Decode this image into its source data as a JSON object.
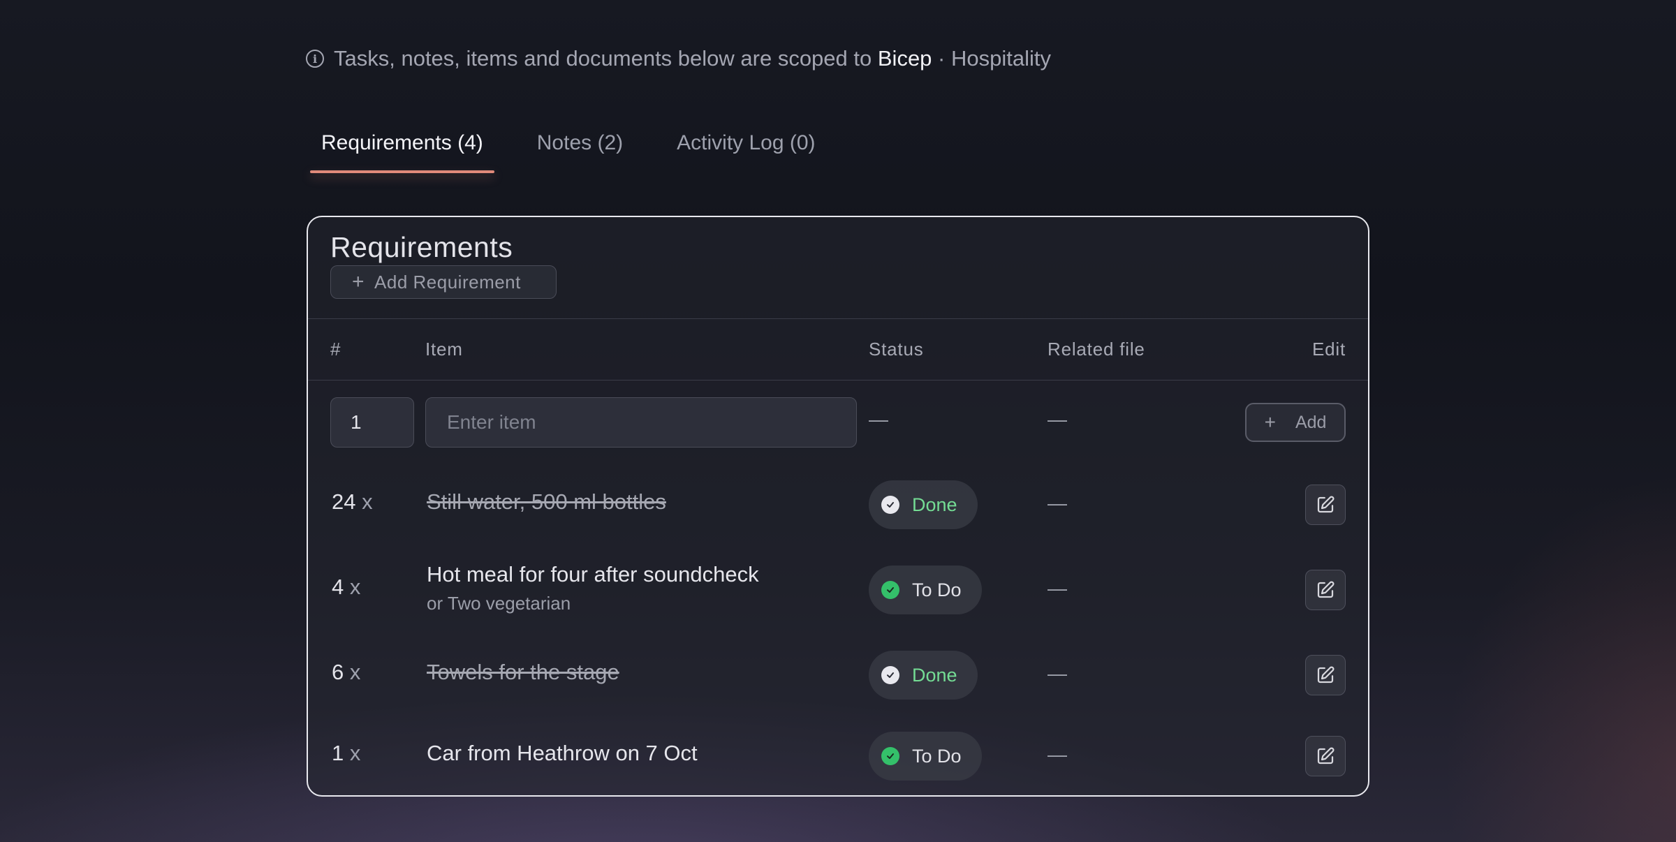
{
  "scope": {
    "prefix": "Tasks, notes, items and documents below are scoped to",
    "entity": "Bicep",
    "separator": "·",
    "category": "Hospitality",
    "icon": "info-icon"
  },
  "tabs": [
    {
      "label": "Requirements (4)",
      "active": true
    },
    {
      "label": "Notes (2)",
      "active": false
    },
    {
      "label": "Activity Log (0)",
      "active": false
    }
  ],
  "card": {
    "title": "Requirements",
    "add_button": "Add Requirement"
  },
  "table": {
    "headers": {
      "num": "#",
      "item": "Item",
      "status": "Status",
      "file": "Related file",
      "edit": "Edit"
    },
    "new_row": {
      "qty_value": "1",
      "item_placeholder": "Enter item",
      "status": "—",
      "file": "—",
      "add_label": "Add"
    },
    "rows": [
      {
        "qty": "24",
        "x": "x",
        "item": "Still water, 500 ml bottles",
        "sub": "",
        "status": "Done",
        "file": "—"
      },
      {
        "qty": "4",
        "x": "x",
        "item": "Hot meal for four after soundcheck",
        "sub": "or Two vegetarian",
        "status": "To Do",
        "file": "—"
      },
      {
        "qty": "6",
        "x": "x",
        "item": "Towels for the stage",
        "sub": "",
        "status": "Done",
        "file": "—"
      },
      {
        "qty": "1",
        "x": "x",
        "item": "Car from Heathrow on 7 Oct",
        "sub": "",
        "status": "To Do",
        "file": "—"
      }
    ]
  },
  "colors": {
    "accent": "#e08a7a",
    "done_text": "#74dc94",
    "todo_icon": "#34c06a"
  }
}
